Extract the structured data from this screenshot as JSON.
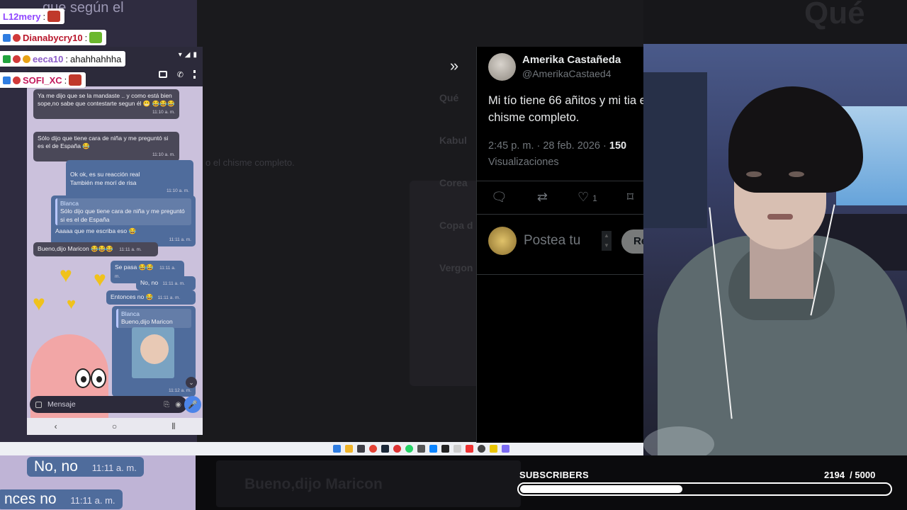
{
  "stream_chat": [
    {
      "user": "L12mery",
      "text": "",
      "name_color": "#9146ff",
      "badges": []
    },
    {
      "user": "Dianabycry10",
      "text": "",
      "name_color": "#b8162b",
      "badges": [
        "#2f7de1",
        "#d13a3a"
      ]
    },
    {
      "user": "eeca10",
      "text": "ahahhahhha",
      "name_color": "#8c5cc9",
      "badges": [
        "#22a33e",
        "#d13a3a",
        "#e8a317"
      ]
    },
    {
      "user": "SOFI_XC",
      "text": "",
      "name_color": "#c2185b",
      "badges": [
        "#2f7de1",
        "#d13a3a"
      ]
    }
  ],
  "phone_chat": {
    "messages": [
      {
        "dir": "in",
        "text": "Ya me dijo que se la mandaste .. y como está bien sope,no sabe que contestarte segun él",
        "time": "11:10 a. m."
      },
      {
        "dir": "in",
        "text": "Sólo dijo que tiene cara de niña y me preguntó si es el de España",
        "time": "11:10 a. m."
      },
      {
        "dir": "out",
        "text": "Ok ok, es su reacción real\nTambién me morí de risa",
        "time": "11:10 a. m."
      },
      {
        "dir": "out",
        "quote_author": "Blanca",
        "quote": "Sólo dijo que tiene cara de niña y me preguntó si es el de España",
        "text": "Aaaaa que me escriba eso",
        "time": "11:11 a. m."
      },
      {
        "dir": "in",
        "text": "Bueno,dijo Maricon",
        "time": "11:11 a. m."
      },
      {
        "dir": "out",
        "text": "Se pasa",
        "time": "11:11 a. m."
      },
      {
        "dir": "out",
        "text": "No, no",
        "time": "11:11 a. m."
      },
      {
        "dir": "out",
        "text": "Entonces no",
        "time": "11:11 a. m."
      },
      {
        "dir": "out",
        "quote_author": "Blanca",
        "quote": "Bueno,dijo Maricon",
        "text": "",
        "time": "11:12 a. m."
      }
    ],
    "input_placeholder": "Mensaje"
  },
  "tweet": {
    "author_name": "Amerika Castañeda",
    "author_handle": "@AmerikaCastaed4",
    "text": "Mi tío tiene 66 añitos y mi tia el chisme completo.",
    "time": "2:45 p. m. · 28 feb. 2026 · ",
    "views_count": "150",
    "views_label": "Visualizaciones",
    "likes": "1",
    "reply_placeholder": "Postea tu",
    "reply_button": "Re",
    "expand_icon": "double-chevron-right"
  },
  "subscribers": {
    "label": "SUBSCRIBERS",
    "current": "2194",
    "goal": "/ 5000",
    "fraction": 0.4388
  },
  "background": {
    "ghost_chat_text": "o el chisme completo.",
    "ghost_title": "Qué",
    "bottom_bubbles": [
      "No, no",
      "nces no"
    ],
    "bottom_time": "11:11 a. m.",
    "bottom_ghost_text": "Bueno,dijo Maricon"
  },
  "colors": {
    "subscriber_bar": "#ffffff",
    "tweet_bg": "#000000",
    "bubble_out": "#4f6c9c",
    "bubble_in": "#4a4858"
  }
}
